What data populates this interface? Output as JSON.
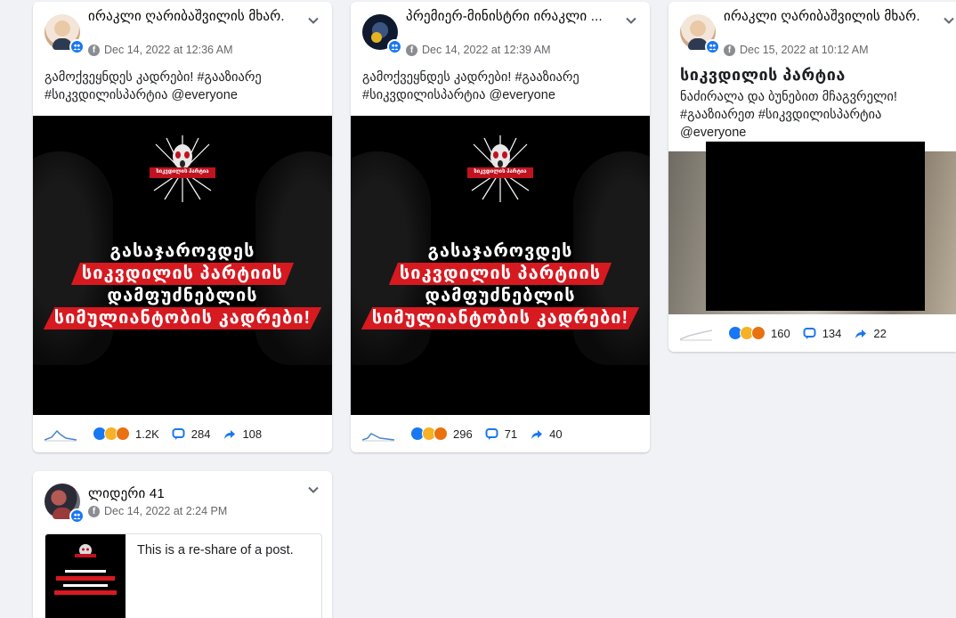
{
  "posts": [
    {
      "author": "ირაკლი ღარიბაშვილის მხარ...",
      "timestamp": "Dec 14, 2022 at 12:36 AM",
      "text_line1": "გამოქვეყნდეს კადრები! #გააზიარე",
      "text_line2": "#სიკვდილისპარტია @everyone",
      "image_caption": [
        "გასაჯაროვდეს",
        "სიკვდილის პარტიის",
        "დამფუძნებლის",
        "სიმულიანტობის კადრები!"
      ],
      "logo_text": "სიკვდილის პარტია",
      "reactions": "1.2K",
      "comments": "284",
      "shares": "108"
    },
    {
      "author": "პრემიერ-მინისტრი ირაკლი ...",
      "timestamp": "Dec 14, 2022 at 12:39 AM",
      "text_line1": "გამოქვეყნდეს კადრები! #გააზიარე",
      "text_line2": "#სიკვდილისპარტია @everyone",
      "image_caption": [
        "გასაჯაროვდეს",
        "სიკვდილის პარტიის",
        "დამფუძნებლის",
        "სიმულიანტობის კადრები!"
      ],
      "logo_text": "სიკვდილის პარტია",
      "reactions": "296",
      "comments": "71",
      "shares": "40"
    },
    {
      "author": "ირაკლი ღარიბაშვილის მხარ...",
      "timestamp": "Dec 15, 2022 at 10:12 AM",
      "title": "სიკვდილის პარტია",
      "text_line1": "ნაძირალა და ბუნებით მჩაგვრელი!",
      "text_line2": "#გააზიარეთ #სიკვდილისპარტია",
      "text_line3": "@everyone",
      "reactions": "160",
      "comments": "134",
      "shares": "22"
    },
    {
      "author": "ლიდერი 41",
      "timestamp": "Dec 14, 2022 at 2:24 PM",
      "reshare_text": "This is a re-share of a post."
    }
  ],
  "colors": {
    "accent": "#1877f2",
    "banner_red": "#d71920",
    "page_bg": "#f0f2f5"
  },
  "icons": [
    "chevron-down-icon",
    "facebook-icon",
    "group-badge-icon",
    "sparkline-icon",
    "reactions-icon",
    "comment-icon",
    "share-icon"
  ]
}
